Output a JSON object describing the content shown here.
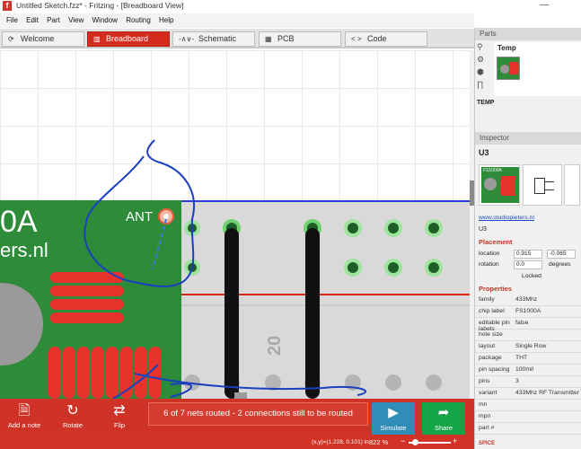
{
  "window": {
    "title": "Untitled Sketch.fzz* - Fritzing - [Breadboard View]",
    "minimize": "—"
  },
  "menu": [
    "File",
    "Edit",
    "Part",
    "View",
    "Window",
    "Routing",
    "Help"
  ],
  "tabs": [
    {
      "label": "Welcome",
      "icon": "⟳"
    },
    {
      "label": "Breadboard",
      "icon": "▥"
    },
    {
      "label": "Schematic",
      "icon": "-∧∨-"
    },
    {
      "label": "PCB",
      "icon": "▦"
    },
    {
      "label": "Code",
      "icon": "< >"
    }
  ],
  "canvas": {
    "module_label": "ANT",
    "module_big": "0A",
    "module_url": "ers.nl",
    "rowcol_number": "20"
  },
  "bottom": {
    "add_note": "Add a note",
    "rotate": "Rotate",
    "flip": "Flip",
    "route_status": "6 of 7 nets routed - 2 connections still to be routed",
    "simulate": "Simulate",
    "share": "Share"
  },
  "status": {
    "coords": "(x,y)=(1.228, 0.101) in",
    "zoom": "822 %",
    "zoom_level": 0.15
  },
  "parts": {
    "header": "Parts",
    "bin_title": "Temp",
    "bin_label": "TEMP"
  },
  "inspector": {
    "header": "Inspector",
    "title": "U3",
    "module_text": "FS1000A",
    "link": "www.studiopieters.nl",
    "name": "U3",
    "placement_label": "Placement",
    "location_label": "location",
    "location_x": "0.915",
    "location_y": "-0.065",
    "rotation_label": "rotation",
    "rotation_value": "0.0",
    "rotation_unit": "degrees",
    "locked_label": "Locked",
    "properties_label": "Properties",
    "properties": [
      {
        "k": "family",
        "v": "433Mhz"
      },
      {
        "k": "chip label",
        "v": "FS1000A"
      },
      {
        "k": "editable pin labels",
        "v": "false"
      },
      {
        "k": "hole size",
        "v": ""
      },
      {
        "k": "layout",
        "v": "Single Row"
      },
      {
        "k": "package",
        "v": "THT"
      },
      {
        "k": "pin spacing",
        "v": "100mil"
      },
      {
        "k": "pins",
        "v": "3"
      },
      {
        "k": "variant",
        "v": "433Mhz RF Transmitter"
      },
      {
        "k": "mn",
        "v": ""
      },
      {
        "k": "mpn",
        "v": ""
      },
      {
        "k": "part #",
        "v": ""
      }
    ],
    "spice_label": "SPICE"
  },
  "colors": {
    "accent": "#d42c1f",
    "pcb_green": "#2e8b3a",
    "sim_blue": "#2f8db8",
    "share_green": "#15a548"
  }
}
